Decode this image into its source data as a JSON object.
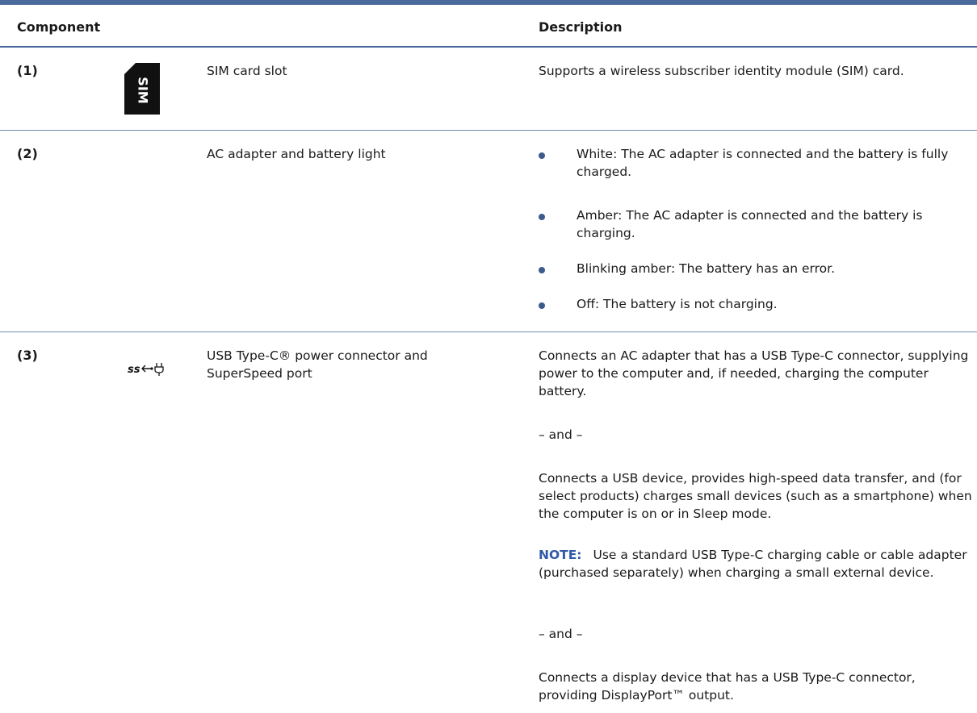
{
  "header": {
    "component": "Component",
    "description": "Description"
  },
  "rows": [
    {
      "number": "(1)",
      "icon": "sim-card-icon",
      "icon_text": "SIM",
      "component": "SIM card slot",
      "description": "Supports a wireless subscriber identity module (SIM) card."
    },
    {
      "number": "(2)",
      "component": "AC adapter and battery light",
      "bullets": [
        "White: The AC adapter is connected and the battery is fully charged.",
        "Amber: The AC adapter is connected and the battery is charging.",
        "Blinking amber: The battery has an error.",
        "Off: The battery is not charging."
      ]
    },
    {
      "number": "(3)",
      "icon": "usb-superspeed-power-icon",
      "icon_text": "ss",
      "component": "USB Type-C® power connector and SuperSpeed port",
      "paragraphs": [
        "Connects an AC adapter that has a USB Type-C connector, supplying power to the computer and, if needed, charging the computer battery.",
        "– and –",
        "Connects a USB device, provides high-speed data transfer, and (for select products) charges small devices (such as a smartphone) when the computer is on or in Sleep mode.",
        "– and –",
        "Connects a display device that has a USB Type-C connector, providing DisplayPort™ output."
      ],
      "note": {
        "label": "NOTE:",
        "text": "Use a standard USB Type-C charging cable or cable adapter (purchased separately) when charging a small external device."
      }
    }
  ],
  "colors": {
    "rule": "#4a6a9c",
    "bullet": "#3c5a8c",
    "note_label": "#2f5aa8"
  }
}
